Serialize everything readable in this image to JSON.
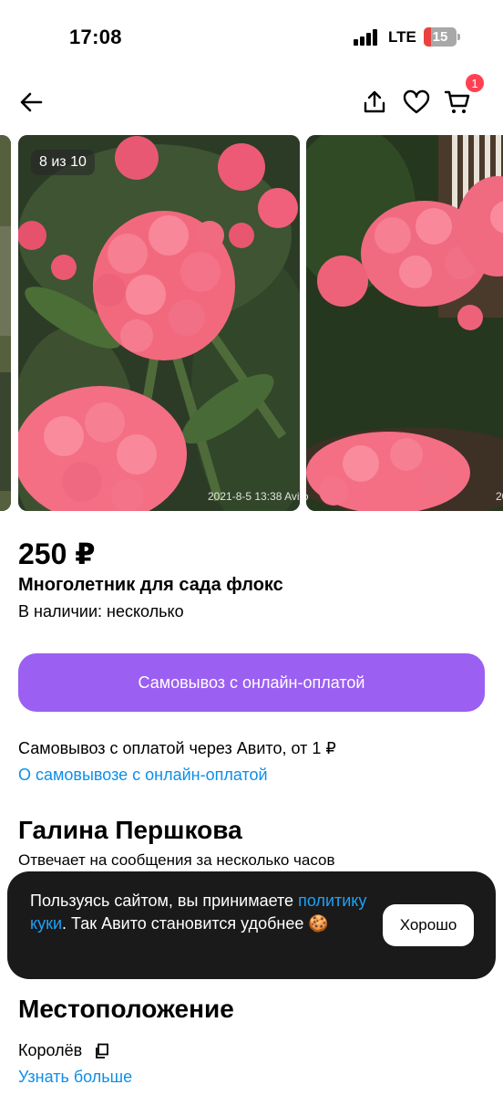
{
  "status_bar": {
    "time": "17:08",
    "network": "LTE",
    "battery": "15"
  },
  "nav": {
    "back_icon": "arrow-left-icon",
    "share_icon": "share-icon",
    "favorite_icon": "heart-icon",
    "cart_icon": "cart-icon",
    "cart_count": "1"
  },
  "gallery": {
    "counter": "8 из 10",
    "timestamp": "2021-8-5 13:38",
    "watermark": "Avito",
    "next_timestamp": "20"
  },
  "listing": {
    "price": "250 ₽",
    "title": "Многолетник для сада флокс",
    "availability": "В наличии: несколько",
    "pickup_button": "Самовывоз с онлайн-оплатой",
    "pickup_text": "Самовывоз с оплатой через Авито, от 1 ₽",
    "pickup_link": "О самовывозе с онлайн-оплатой"
  },
  "seller": {
    "name": "Галина Першкова",
    "reply_time": "Отвечает на сообщения за несколько часов"
  },
  "cookie_banner": {
    "text_before": "Пользуясь сайтом, вы принимаете ",
    "link": "политику куки",
    "text_after": ". Так Авито становится удобнее 🍪",
    "button": "Хорошо"
  },
  "location": {
    "heading": "Местоположение",
    "city": "Королёв",
    "learn_more": "Узнать больше"
  },
  "colors": {
    "accent_purple": "#9b5ff1",
    "link_blue": "#0d8fe8",
    "badge_red": "#ff4053"
  }
}
